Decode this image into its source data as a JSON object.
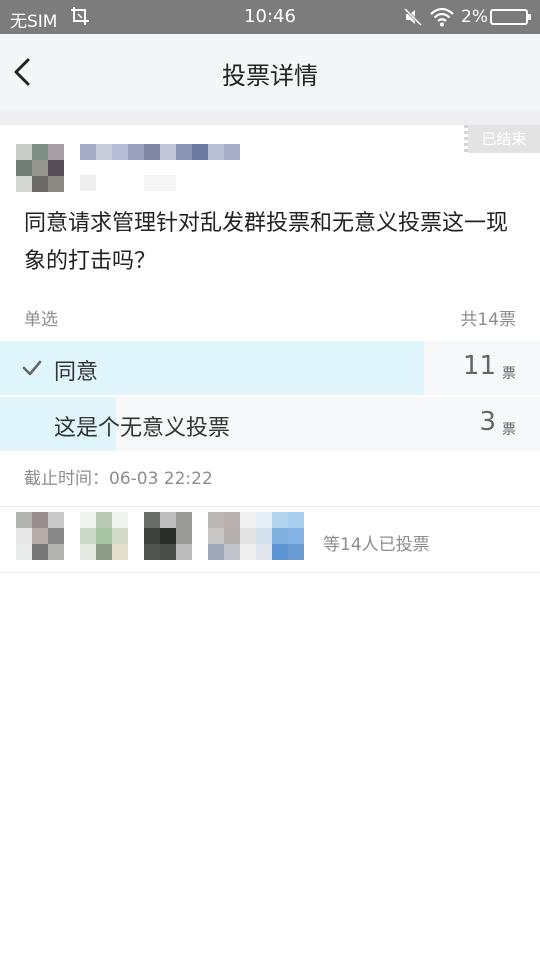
{
  "status_bar": {
    "carrier": "无SIM",
    "time": "10:46",
    "battery": "2%",
    "icons": [
      "screenshot-icon",
      "mute-icon",
      "wifi-icon",
      "battery-icon"
    ]
  },
  "nav": {
    "title": "投票详情",
    "back_icon": "chevron-left-icon"
  },
  "poll": {
    "status_tag": "已结束",
    "question": "同意请求管理针对乱发群投票和无意义投票这一现象的打击吗？",
    "type_label": "单选",
    "total_votes": "共14票",
    "options": [
      {
        "label": "同意",
        "count": "11",
        "unit": "票",
        "share": 0.786,
        "selected": true
      },
      {
        "label": "这是个无意义投票",
        "count": "3",
        "unit": "票",
        "share": 0.214,
        "selected": false
      }
    ],
    "deadline": "截止时间：06-03 22:22",
    "voters_summary": "等14人已投票"
  },
  "colors": {
    "status_bar_bg": "#7c7c7c",
    "nav_bg": "#f4f5f7",
    "option_fill": "#e0f5fb",
    "secondary_text": "#8d8d8d"
  }
}
